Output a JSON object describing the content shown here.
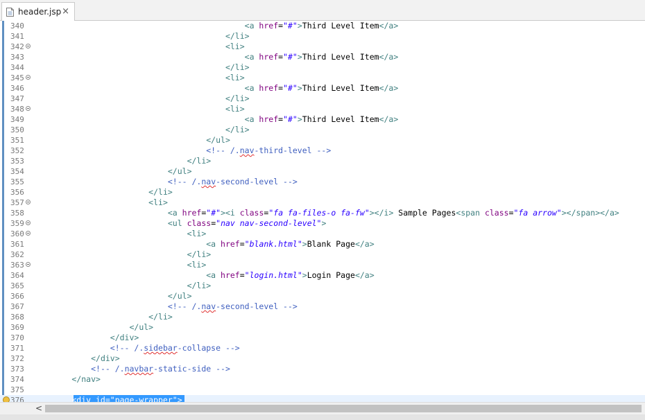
{
  "tab": {
    "title": "header.jsp",
    "close": "×"
  },
  "scrollbar": {
    "left_arrow": "<"
  },
  "lines": [
    {
      "n": "340",
      "ind": 44,
      "parts": [
        [
          "t",
          "<a "
        ],
        [
          "a",
          "href"
        ],
        [
          "x",
          "="
        ],
        [
          "v",
          "\"#\""
        ],
        [
          "t",
          ">"
        ],
        [
          "x",
          "Third Level Item"
        ],
        [
          "t",
          "</a>"
        ]
      ]
    },
    {
      "n": "341",
      "ind": 40,
      "parts": [
        [
          "t",
          "</li>"
        ]
      ]
    },
    {
      "n": "342",
      "ind": 40,
      "fold": true,
      "parts": [
        [
          "t",
          "<li>"
        ]
      ]
    },
    {
      "n": "343",
      "ind": 44,
      "parts": [
        [
          "t",
          "<a "
        ],
        [
          "a",
          "href"
        ],
        [
          "x",
          "="
        ],
        [
          "v",
          "\"#\""
        ],
        [
          "t",
          ">"
        ],
        [
          "x",
          "Third Level Item"
        ],
        [
          "t",
          "</a>"
        ]
      ]
    },
    {
      "n": "344",
      "ind": 40,
      "parts": [
        [
          "t",
          "</li>"
        ]
      ]
    },
    {
      "n": "345",
      "ind": 40,
      "fold": true,
      "parts": [
        [
          "t",
          "<li>"
        ]
      ]
    },
    {
      "n": "346",
      "ind": 44,
      "parts": [
        [
          "t",
          "<a "
        ],
        [
          "a",
          "href"
        ],
        [
          "x",
          "="
        ],
        [
          "v",
          "\"#\""
        ],
        [
          "t",
          ">"
        ],
        [
          "x",
          "Third Level Item"
        ],
        [
          "t",
          "</a>"
        ]
      ]
    },
    {
      "n": "347",
      "ind": 40,
      "parts": [
        [
          "t",
          "</li>"
        ]
      ]
    },
    {
      "n": "348",
      "ind": 40,
      "fold": true,
      "parts": [
        [
          "t",
          "<li>"
        ]
      ]
    },
    {
      "n": "349",
      "ind": 44,
      "parts": [
        [
          "t",
          "<a "
        ],
        [
          "a",
          "href"
        ],
        [
          "x",
          "="
        ],
        [
          "v",
          "\"#\""
        ],
        [
          "t",
          ">"
        ],
        [
          "x",
          "Third Level Item"
        ],
        [
          "t",
          "</a>"
        ]
      ]
    },
    {
      "n": "350",
      "ind": 40,
      "parts": [
        [
          "t",
          "</li>"
        ]
      ]
    },
    {
      "n": "351",
      "ind": 36,
      "parts": [
        [
          "t",
          "</ul>"
        ]
      ]
    },
    {
      "n": "352",
      "ind": 36,
      "parts": [
        [
          "c",
          "<!-- /."
        ],
        [
          "cs",
          "nav"
        ],
        [
          "c",
          "-third-level -->"
        ]
      ]
    },
    {
      "n": "353",
      "ind": 32,
      "parts": [
        [
          "t",
          "</li>"
        ]
      ]
    },
    {
      "n": "354",
      "ind": 28,
      "parts": [
        [
          "t",
          "</ul>"
        ]
      ]
    },
    {
      "n": "355",
      "ind": 28,
      "parts": [
        [
          "c",
          "<!-- /."
        ],
        [
          "cs",
          "nav"
        ],
        [
          "c",
          "-second-level -->"
        ]
      ]
    },
    {
      "n": "356",
      "ind": 24,
      "parts": [
        [
          "t",
          "</li>"
        ]
      ]
    },
    {
      "n": "357",
      "ind": 24,
      "fold": true,
      "parts": [
        [
          "t",
          "<li>"
        ]
      ]
    },
    {
      "n": "358",
      "ind": 28,
      "parts": [
        [
          "t",
          "<a "
        ],
        [
          "a",
          "href"
        ],
        [
          "x",
          "="
        ],
        [
          "v",
          "\"#\""
        ],
        [
          "t",
          "><i "
        ],
        [
          "a",
          "class"
        ],
        [
          "x",
          "="
        ],
        [
          "v",
          "\"fa fa-files-o fa-fw\""
        ],
        [
          "t",
          "></i>"
        ],
        [
          "x",
          " Sample Pages"
        ],
        [
          "t",
          "<span "
        ],
        [
          "a",
          "class"
        ],
        [
          "x",
          "="
        ],
        [
          "v",
          "\"fa arrow\""
        ],
        [
          "t",
          "></span></a>"
        ]
      ]
    },
    {
      "n": "359",
      "ind": 28,
      "fold": true,
      "parts": [
        [
          "t",
          "<ul "
        ],
        [
          "a",
          "class"
        ],
        [
          "x",
          "="
        ],
        [
          "v",
          "\"nav nav-second-level\""
        ],
        [
          "t",
          ">"
        ]
      ]
    },
    {
      "n": "360",
      "ind": 32,
      "fold": true,
      "parts": [
        [
          "t",
          "<li>"
        ]
      ]
    },
    {
      "n": "361",
      "ind": 36,
      "parts": [
        [
          "t",
          "<a "
        ],
        [
          "a",
          "href"
        ],
        [
          "x",
          "="
        ],
        [
          "v",
          "\"blank.html\""
        ],
        [
          "t",
          ">"
        ],
        [
          "x",
          "Blank Page"
        ],
        [
          "t",
          "</a>"
        ]
      ]
    },
    {
      "n": "362",
      "ind": 32,
      "parts": [
        [
          "t",
          "</li>"
        ]
      ]
    },
    {
      "n": "363",
      "ind": 32,
      "fold": true,
      "parts": [
        [
          "t",
          "<li>"
        ]
      ]
    },
    {
      "n": "364",
      "ind": 36,
      "parts": [
        [
          "t",
          "<a "
        ],
        [
          "a",
          "href"
        ],
        [
          "x",
          "="
        ],
        [
          "v",
          "\"login.html\""
        ],
        [
          "t",
          ">"
        ],
        [
          "x",
          "Login Page"
        ],
        [
          "t",
          "</a>"
        ]
      ]
    },
    {
      "n": "365",
      "ind": 32,
      "parts": [
        [
          "t",
          "</li>"
        ]
      ]
    },
    {
      "n": "366",
      "ind": 28,
      "parts": [
        [
          "t",
          "</ul>"
        ]
      ]
    },
    {
      "n": "367",
      "ind": 28,
      "parts": [
        [
          "c",
          "<!-- /."
        ],
        [
          "cs",
          "nav"
        ],
        [
          "c",
          "-second-level -->"
        ]
      ]
    },
    {
      "n": "368",
      "ind": 24,
      "parts": [
        [
          "t",
          "</li>"
        ]
      ]
    },
    {
      "n": "369",
      "ind": 20,
      "parts": [
        [
          "t",
          "</ul>"
        ]
      ]
    },
    {
      "n": "370",
      "ind": 16,
      "parts": [
        [
          "t",
          "</div>"
        ]
      ]
    },
    {
      "n": "371",
      "ind": 16,
      "parts": [
        [
          "c",
          "<!-- /."
        ],
        [
          "cs",
          "sidebar"
        ],
        [
          "c",
          "-collapse -->"
        ]
      ]
    },
    {
      "n": "372",
      "ind": 12,
      "parts": [
        [
          "t",
          "</div>"
        ]
      ]
    },
    {
      "n": "373",
      "ind": 12,
      "parts": [
        [
          "c",
          "<!-- /."
        ],
        [
          "cs",
          "navbar"
        ],
        [
          "c",
          "-static-side -->"
        ]
      ]
    },
    {
      "n": "374",
      "ind": 8,
      "parts": [
        [
          "t",
          "</nav>"
        ]
      ]
    },
    {
      "n": "375",
      "ind": 0,
      "parts": []
    },
    {
      "n": "376",
      "ind": 8,
      "current": true,
      "warn": true,
      "selected": "<div id=\"page-wrapper\">",
      "parts": []
    }
  ]
}
